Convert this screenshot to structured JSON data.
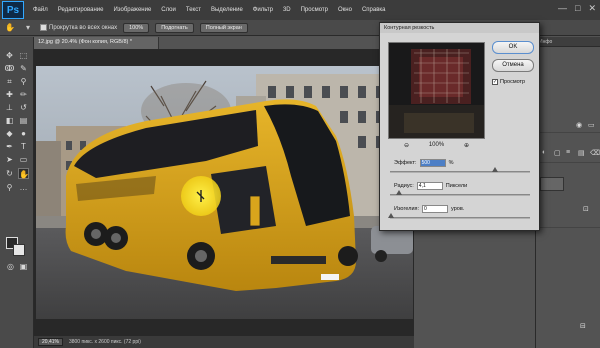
{
  "app": {
    "logo": "Ps",
    "menu": [
      "Файл",
      "Редактирование",
      "Изображение",
      "Слои",
      "Текст",
      "Выделение",
      "Фильтр",
      "3D",
      "Просмотр",
      "Окно",
      "Справка"
    ],
    "window_controls": [
      "—",
      "□",
      "✕"
    ]
  },
  "options_bar": {
    "scroll_all_label": "Прокрутка во всех окнах",
    "zoom_100": "100%",
    "fit_screen": "Подогнать",
    "fill_screen": "Полный экран"
  },
  "document": {
    "tab_title": "12.jpg @ 20.4% (Фон копия, RGB/8) *",
    "zoom_status": "20,41%",
    "doc_info": "3800 пикс. x 2600 пикс. (72 ppi)"
  },
  "dialog": {
    "title": "Контурная резкость",
    "ok_label": "OK",
    "cancel_label": "Отмена",
    "preview_label": "Просмотр",
    "preview_checked": "✓",
    "zoom_out_icon": "⊖",
    "zoom_value": "100%",
    "zoom_in_icon": "⊕",
    "amount_label": "Эффект:",
    "amount_value": "500",
    "amount_unit": "%",
    "radius_label": "Радиус:",
    "radius_value": "4,1",
    "radius_unit": "Пиксели",
    "threshold_label": "Изогелия:",
    "threshold_value": "0",
    "threshold_unit": "уров."
  },
  "panels": {
    "side_label": "Инфо"
  }
}
